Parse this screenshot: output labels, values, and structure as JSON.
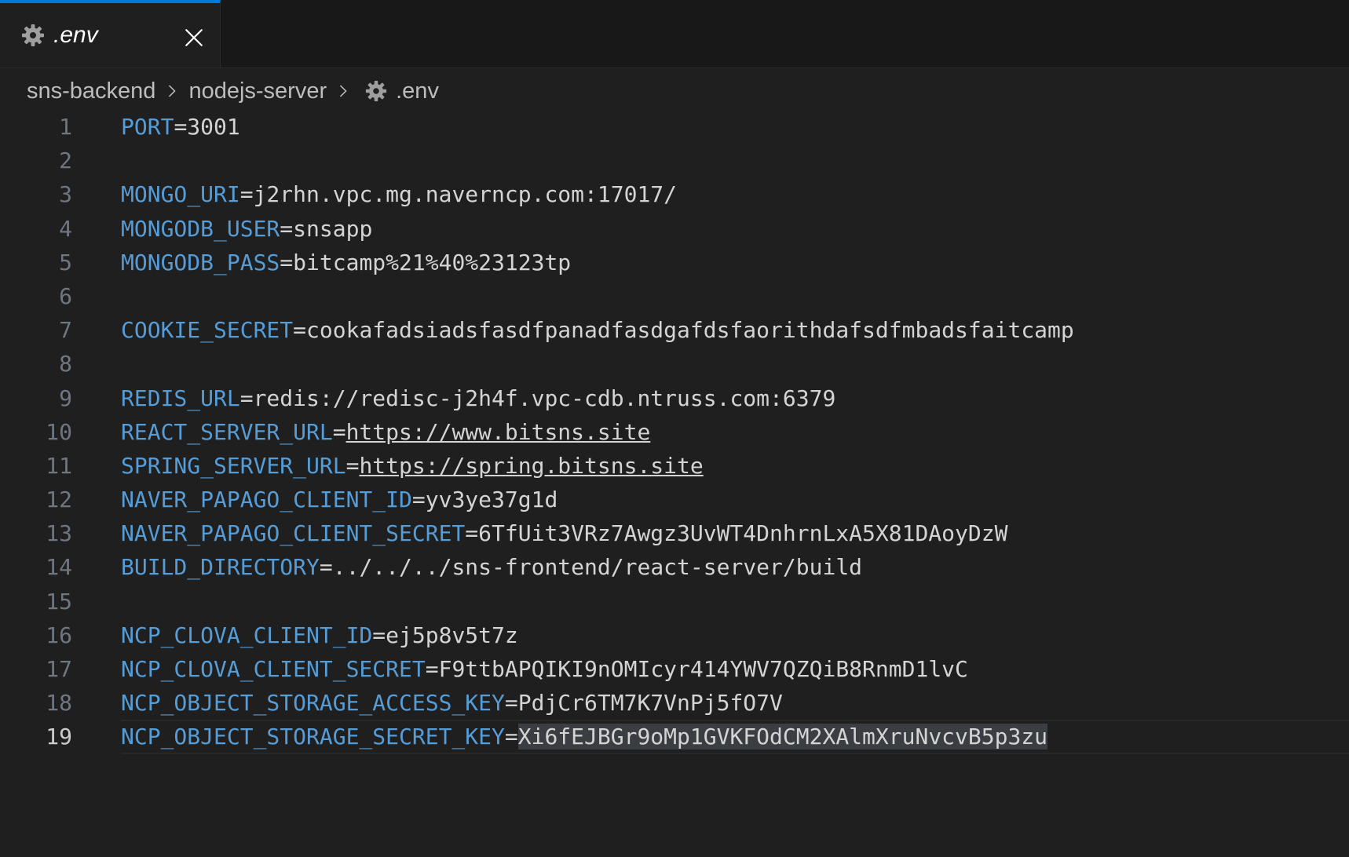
{
  "tab": {
    "label": ".env",
    "icon": "gear-icon",
    "close_icon": "close-icon"
  },
  "breadcrumb": {
    "items": [
      "sns-backend",
      "nodejs-server",
      ".env"
    ],
    "separator_icon": "chevron-right-icon",
    "file_icon": "gear-icon"
  },
  "editor": {
    "current_line": 19,
    "lines": [
      {
        "num": "1",
        "key": "PORT",
        "eq": "=",
        "value": "3001"
      },
      {
        "num": "2",
        "key": "",
        "eq": "",
        "value": ""
      },
      {
        "num": "3",
        "key": "MONGO_URI",
        "eq": "=",
        "value": "j2rhn.vpc.mg.naverncp.com:17017/"
      },
      {
        "num": "4",
        "key": "MONGODB_USER",
        "eq": "=",
        "value": "snsapp"
      },
      {
        "num": "5",
        "key": "MONGODB_PASS",
        "eq": "=",
        "value": "bitcamp%21%40%23123tp"
      },
      {
        "num": "6",
        "key": "",
        "eq": "",
        "value": ""
      },
      {
        "num": "7",
        "key": "COOKIE_SECRET",
        "eq": "=",
        "value": "cookafadsiadsfasdfpanadfasdgafdsfaorithdafsdfmbadsfaitcamp"
      },
      {
        "num": "8",
        "key": "",
        "eq": "",
        "value": ""
      },
      {
        "num": "9",
        "key": "REDIS_URL",
        "eq": "=",
        "value": "redis://redisc-j2h4f.vpc-cdb.ntruss.com:6379"
      },
      {
        "num": "10",
        "key": "REACT_SERVER_URL",
        "eq": "=",
        "value": "https://www.bitsns.site",
        "link": true
      },
      {
        "num": "11",
        "key": "SPRING_SERVER_URL",
        "eq": "=",
        "value": "https://spring.bitsns.site",
        "link": true
      },
      {
        "num": "12",
        "key": "NAVER_PAPAGO_CLIENT_ID",
        "eq": "=",
        "value": "yv3ye37g1d"
      },
      {
        "num": "13",
        "key": "NAVER_PAPAGO_CLIENT_SECRET",
        "eq": "=",
        "value": "6TfUit3VRz7Awgz3UvWT4DnhrnLxA5X81DAoyDzW"
      },
      {
        "num": "14",
        "key": "BUILD_DIRECTORY",
        "eq": "=",
        "value": "../../../sns-frontend/react-server/build"
      },
      {
        "num": "15",
        "key": "",
        "eq": "",
        "value": ""
      },
      {
        "num": "16",
        "key": "NCP_CLOVA_CLIENT_ID",
        "eq": "=",
        "value": "ej5p8v5t7z"
      },
      {
        "num": "17",
        "key": "NCP_CLOVA_CLIENT_SECRET",
        "eq": "=",
        "value": "F9ttbAPQIKI9nOMIcyr414YWV7QZQiB8RnmD1lvC"
      },
      {
        "num": "18",
        "key": "NCP_OBJECT_STORAGE_ACCESS_KEY",
        "eq": "=",
        "value": "PdjCr6TM7K7VnPj5fO7V"
      },
      {
        "num": "19",
        "key": "NCP_OBJECT_STORAGE_SECRET_KEY",
        "eq": "=",
        "value": "Xi6fEJBGr9oMp1GVKFOdCM2XAlmXruNvcvB5p3zu",
        "selected": true
      }
    ]
  },
  "colors": {
    "background": "#1f1f1f",
    "tabbar_background": "#181818",
    "active_tab_border": "#0078d4",
    "key": "#569cd6",
    "value": "#d4d4d4",
    "line_number": "#6e7681",
    "selection": "#3a3d41"
  }
}
